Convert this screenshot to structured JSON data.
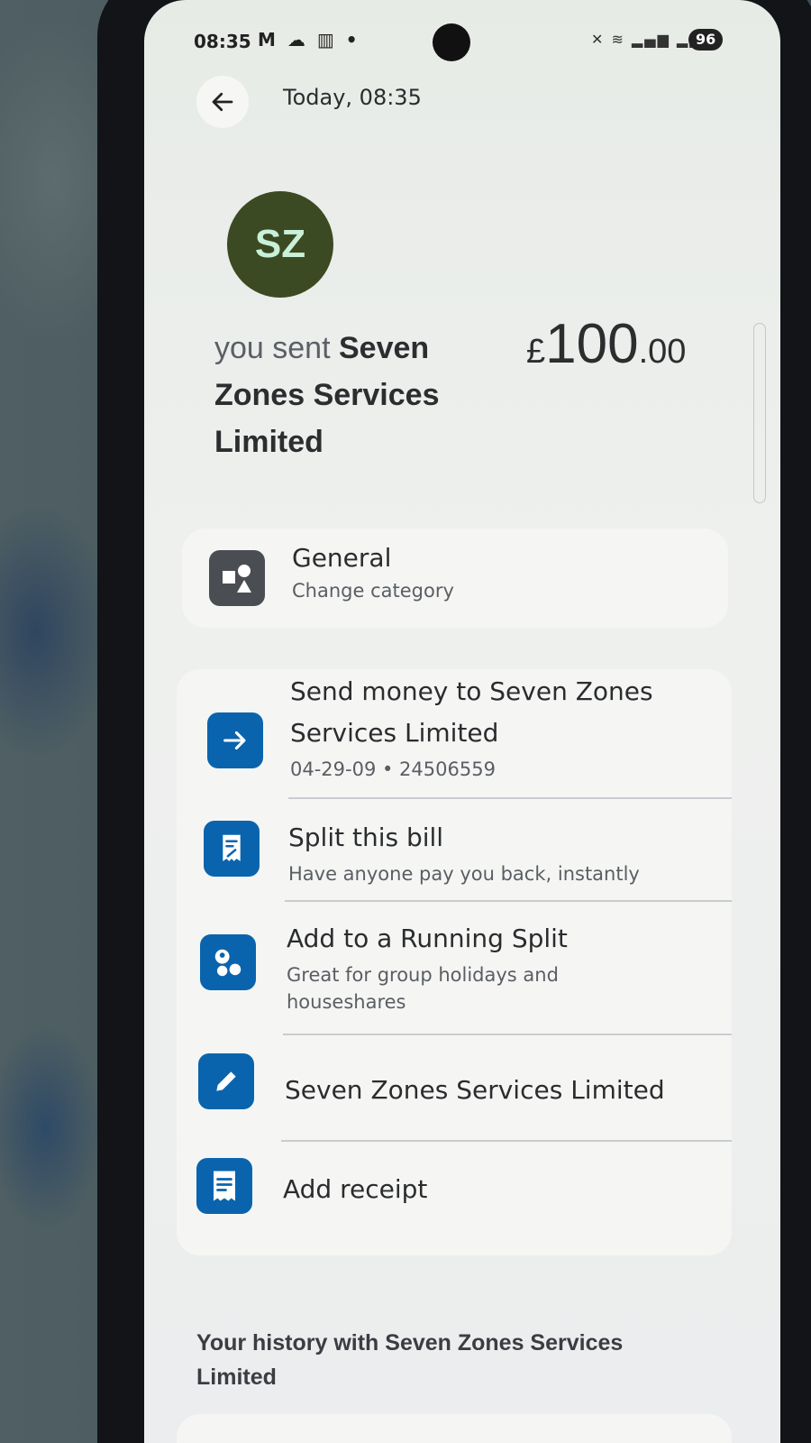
{
  "status_bar": {
    "time": "08:35",
    "left_icons": "M ☁ ▥ •",
    "right_icons": "✕ ≋ ▂▄▆ ▂▄▆",
    "battery": "96"
  },
  "header": {
    "title": "Today, 08:35"
  },
  "avatar": {
    "initials": "SZ",
    "color": "#3b4a22"
  },
  "summary": {
    "prefix": "you sent ",
    "payee": "Seven Zones Services Limited",
    "amount_currency": "£",
    "amount_whole": "100",
    "amount_pence": ".00"
  },
  "category": {
    "title": "General",
    "subtitle": "Change category",
    "icon": "category-shapes-icon"
  },
  "actions": [
    {
      "title": "Send money to Seven Zones Services Limited",
      "subtitle": "04-29-09 • 24506559",
      "icon": "arrow-right-icon"
    },
    {
      "title": "Split this bill",
      "subtitle": "Have anyone pay you back, instantly",
      "icon": "split-bill-icon"
    },
    {
      "title": "Add to a Running Split",
      "subtitle": "Great for group holidays and houseshares",
      "icon": "group-icon"
    },
    {
      "title": "Seven Zones Services Limited",
      "subtitle": "",
      "icon": "pencil-icon"
    },
    {
      "title": "Add receipt",
      "subtitle": "",
      "icon": "receipt-icon"
    }
  ],
  "history": {
    "heading": "Your history with Seven Zones Services Limited"
  },
  "colors": {
    "accent_blue": "#0a64ad",
    "category_grey": "#4a4d52"
  }
}
